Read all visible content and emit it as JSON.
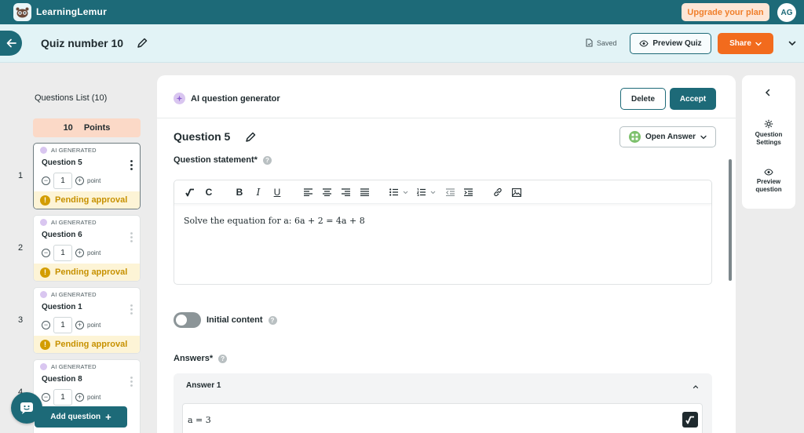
{
  "app": {
    "brand": "LearningLemur",
    "upgrade_label": "Upgrade your plan",
    "avatar_initials": "AG"
  },
  "header": {
    "quiz_title": "Quiz number 10",
    "saved_label": "Saved",
    "preview_label": "Preview Quiz",
    "share_label": "Share"
  },
  "sidebar": {
    "title": "Questions List (10)",
    "points_value": "10",
    "points_label": "Points",
    "add_question_label": "Add question",
    "questions": [
      {
        "index": "1",
        "tag": "AI GENERATED",
        "label": "Question 5",
        "points": "1",
        "unit": "point",
        "status": "Pending approval"
      },
      {
        "index": "2",
        "tag": "AI GENERATED",
        "label": "Question 6",
        "points": "1",
        "unit": "point",
        "status": "Pending approval"
      },
      {
        "index": "3",
        "tag": "AI GENERATED",
        "label": "Question 1",
        "points": "1",
        "unit": "point",
        "status": "Pending approval"
      },
      {
        "index": "4",
        "tag": "AI GENERATED",
        "label": "Question 8",
        "points": "1",
        "unit": "point",
        "status": ""
      }
    ]
  },
  "editor": {
    "generator_label": "AI question generator",
    "delete_label": "Delete",
    "accept_label": "Accept",
    "question_title": "Question 5",
    "answer_type_label": "Open Answer",
    "statement_label": "Question statement*",
    "statement_text": "Solve the equation for a: 6a + 2 = 4a + 8",
    "initial_content_label": "Initial content",
    "answers_label": "Answers*",
    "answer1_title": "Answer 1",
    "answer1_value": "a = 3"
  },
  "right_panel": {
    "settings_label": "Question Settings",
    "preview_label": "Preview question"
  },
  "colors": {
    "primary": "#1d6a78",
    "accent": "#f26b1d",
    "pending": "#c79100"
  }
}
